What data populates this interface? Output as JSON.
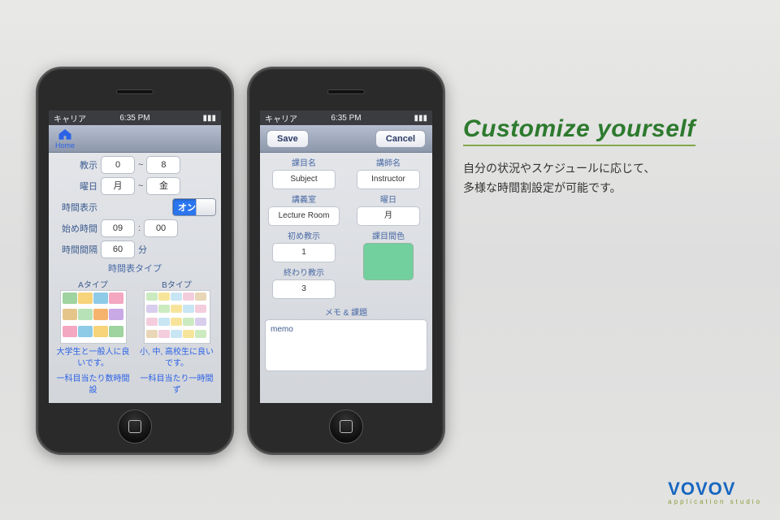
{
  "status": {
    "carrier": "キャリア",
    "time": "6:35 PM",
    "battery_icon": "battery-icon"
  },
  "phone1": {
    "home_label": "Home",
    "rows": {
      "kyoji_label": "教示",
      "kyoji_from": "0",
      "kyoji_to": "8",
      "youbi_label": "曜日",
      "youbi_from": "月",
      "youbi_to": "金",
      "time_display_label": "時間表示",
      "toggle_on": "オン",
      "start_time_label": "始め時間",
      "start_h": "09",
      "start_m": "00",
      "interval_label": "時間間隔",
      "interval_val": "60",
      "interval_unit": "分",
      "tilde": "~",
      "colon": ":"
    },
    "types_header": "時間表タイプ",
    "typeA": {
      "name": "Aタイプ",
      "desc1": "大学生と一般人に良いです。",
      "desc2": "一科目当たり数時間設"
    },
    "typeB": {
      "name": "Bタイプ",
      "desc1": "小, 中, 高校生に良いです。",
      "desc2": "一科目当たり一時間ず"
    }
  },
  "phone2": {
    "save": "Save",
    "cancel": "Cancel",
    "subject_label": "課目名",
    "subject_val": "Subject",
    "instructor_label": "講師名",
    "instructor_val": "Instructor",
    "room_label": "講義室",
    "room_val": "Lecture Room",
    "day_label": "曜日",
    "day_val": "月",
    "start_period_label": "初め教示",
    "start_period_val": "1",
    "color_label": "課目間色",
    "end_period_label": "終わり教示",
    "end_period_val": "3",
    "memo_label": "メモ & 課題",
    "memo_placeholder": "memo"
  },
  "feature": {
    "title": "Customize yourself",
    "desc_l1": "自分の状況やスケジュールに応じて、",
    "desc_l2": "多様な時間割設定が可能です。"
  },
  "brand": {
    "name": "VOVOV",
    "tag": "application studio"
  }
}
